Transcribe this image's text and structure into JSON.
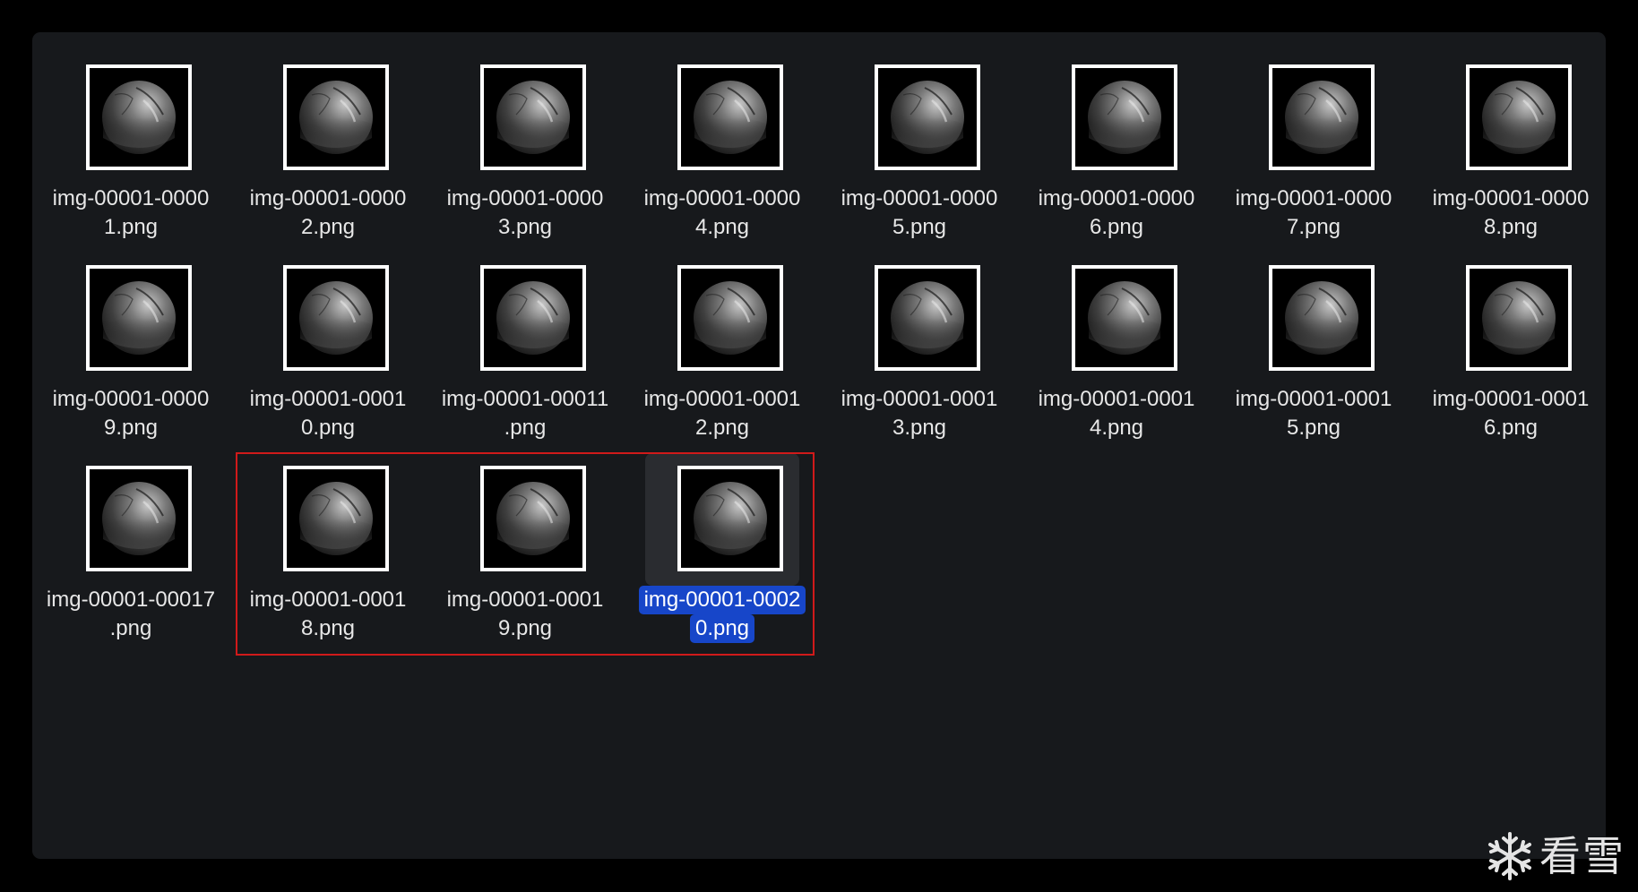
{
  "window": {
    "background": "#17191c"
  },
  "files": [
    {
      "line1": "img-00001-0000",
      "line2": "1.png"
    },
    {
      "line1": "img-00001-0000",
      "line2": "2.png"
    },
    {
      "line1": "img-00001-0000",
      "line2": "3.png"
    },
    {
      "line1": "img-00001-0000",
      "line2": "4.png"
    },
    {
      "line1": "img-00001-0000",
      "line2": "5.png"
    },
    {
      "line1": "img-00001-0000",
      "line2": "6.png"
    },
    {
      "line1": "img-00001-0000",
      "line2": "7.png"
    },
    {
      "line1": "img-00001-0000",
      "line2": "8.png"
    },
    {
      "line1": "img-00001-0000",
      "line2": "9.png"
    },
    {
      "line1": "img-00001-0001",
      "line2": "0.png"
    },
    {
      "line1": "img-00001-00011",
      "line2": ".png"
    },
    {
      "line1": "img-00001-0001",
      "line2": "2.png"
    },
    {
      "line1": "img-00001-0001",
      "line2": "3.png"
    },
    {
      "line1": "img-00001-0001",
      "line2": "4.png"
    },
    {
      "line1": "img-00001-0001",
      "line2": "5.png"
    },
    {
      "line1": "img-00001-0001",
      "line2": "6.png"
    },
    {
      "line1": "img-00001-00017",
      "line2": ".png"
    },
    {
      "line1": "img-00001-0001",
      "line2": "8.png"
    },
    {
      "line1": "img-00001-0001",
      "line2": "9.png"
    },
    {
      "line1": "img-00001-0002",
      "line2": "0.png",
      "selected": true
    }
  ],
  "annotation": {
    "color": "#d01a1a"
  },
  "selection_color": "#1746c9",
  "watermark": {
    "text": "看雪",
    "icon": "snowflake-icon"
  }
}
